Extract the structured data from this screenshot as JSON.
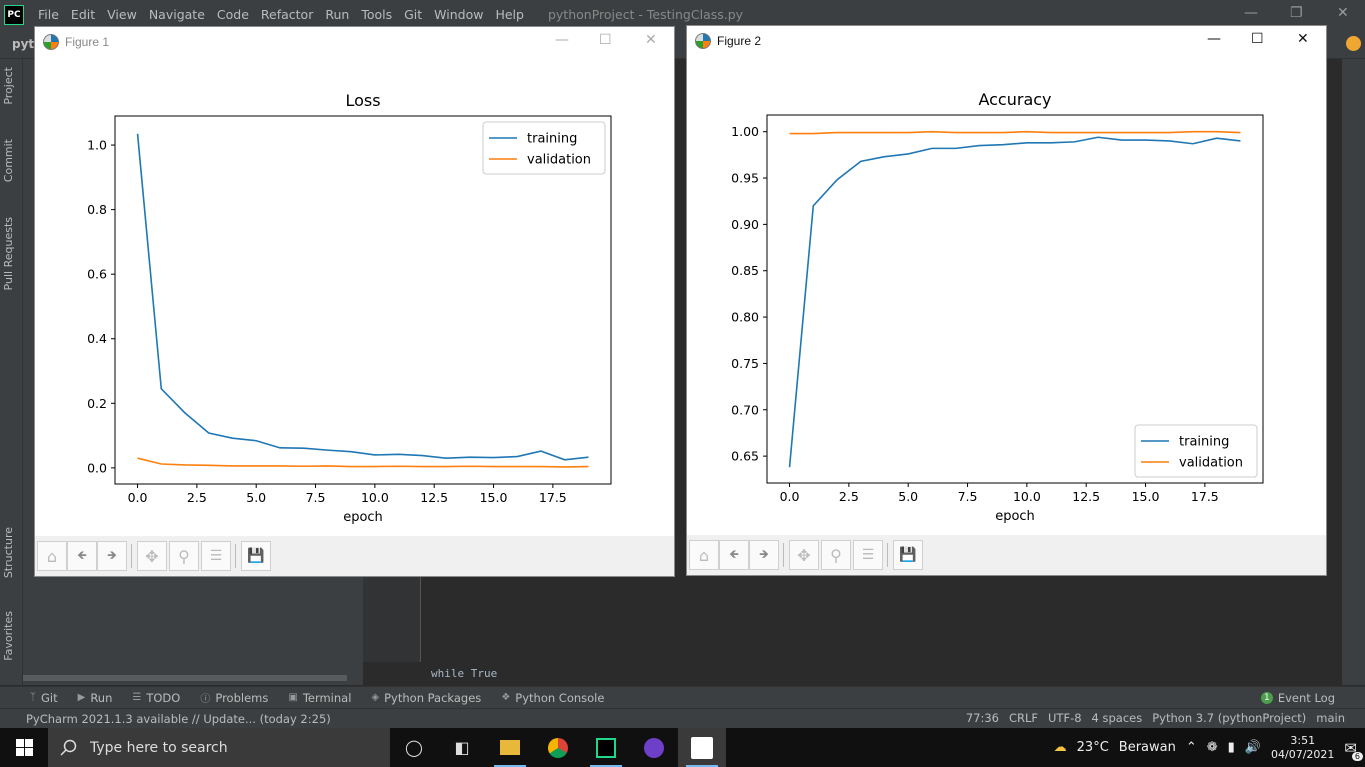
{
  "ide": {
    "logo": "PC",
    "menu": [
      "File",
      "Edit",
      "View",
      "Navigate",
      "Code",
      "Refactor",
      "Run",
      "Tools",
      "Git",
      "Window",
      "Help"
    ],
    "window_title": "pythonProject - TestingClass.py",
    "project_crumb": "pyth",
    "left_tabs": [
      "Project",
      "Commit",
      "Pull Requests",
      "Structure",
      "Favorites"
    ],
    "editor_snippet": "while True",
    "tool_tabs": [
      {
        "icon": "git-icon",
        "label": "Git"
      },
      {
        "icon": "run-icon",
        "label": "Run"
      },
      {
        "icon": "todo-icon",
        "label": "TODO"
      },
      {
        "icon": "problems-icon",
        "label": "Problems"
      },
      {
        "icon": "terminal-icon",
        "label": "Terminal"
      },
      {
        "icon": "python-packages-icon",
        "label": "Python Packages"
      },
      {
        "icon": "python-console-icon",
        "label": "Python Console"
      }
    ],
    "event_log": {
      "count": "1",
      "label": "Event Log"
    },
    "status": {
      "message": "PyCharm 2021.1.3 available // Update... (today 2:25)",
      "position": "77:36",
      "line_sep": "CRLF",
      "encoding": "UTF-8",
      "indent": "4 spaces",
      "interpreter": "Python 3.7 (pythonProject)",
      "branch": "main"
    }
  },
  "taskbar": {
    "search_placeholder": "Type here to search",
    "weather_temp": "23°C",
    "weather_text": "Berawan",
    "time": "3:51",
    "date": "04/07/2021",
    "notifications": "6"
  },
  "figure1": {
    "title": "Figure 1"
  },
  "figure2": {
    "title": "Figure 2"
  },
  "colors": {
    "training": "#1f77b4",
    "validation": "#ff7f0e"
  },
  "chart_data": [
    {
      "type": "line",
      "title": "Loss",
      "xlabel": "epoch",
      "ylabel": "",
      "x": [
        0,
        1,
        2,
        3,
        4,
        5,
        6,
        7,
        8,
        9,
        10,
        11,
        12,
        13,
        14,
        15,
        16,
        17,
        18,
        19
      ],
      "xlim": [
        -0.95,
        19.95
      ],
      "ylim": [
        -0.05,
        1.09
      ],
      "xticks": [
        0.0,
        2.5,
        5.0,
        7.5,
        10.0,
        12.5,
        15.0,
        17.5
      ],
      "xtick_labels": [
        "0.0",
        "2.5",
        "5.0",
        "7.5",
        "10.0",
        "12.5",
        "15.0",
        "17.5"
      ],
      "yticks": [
        0.0,
        0.2,
        0.4,
        0.6,
        0.8,
        1.0
      ],
      "ytick_labels": [
        "0.0",
        "0.2",
        "0.4",
        "0.6",
        "0.8",
        "1.0"
      ],
      "legend_position": "upper right",
      "series": [
        {
          "name": "training",
          "values": [
            1.035,
            0.245,
            0.17,
            0.108,
            0.092,
            0.084,
            0.062,
            0.061,
            0.055,
            0.05,
            0.04,
            0.042,
            0.038,
            0.03,
            0.033,
            0.032,
            0.035,
            0.052,
            0.025,
            0.033
          ]
        },
        {
          "name": "validation",
          "values": [
            0.03,
            0.012,
            0.009,
            0.008,
            0.006,
            0.006,
            0.006,
            0.005,
            0.006,
            0.004,
            0.004,
            0.005,
            0.004,
            0.004,
            0.005,
            0.004,
            0.004,
            0.004,
            0.003,
            0.004
          ]
        }
      ]
    },
    {
      "type": "line",
      "title": "Accuracy",
      "xlabel": "epoch",
      "ylabel": "",
      "x": [
        0,
        1,
        2,
        3,
        4,
        5,
        6,
        7,
        8,
        9,
        10,
        11,
        12,
        13,
        14,
        15,
        16,
        17,
        18,
        19
      ],
      "xlim": [
        -0.95,
        19.95
      ],
      "ylim": [
        0.621,
        1.018
      ],
      "xticks": [
        0.0,
        2.5,
        5.0,
        7.5,
        10.0,
        12.5,
        15.0,
        17.5
      ],
      "xtick_labels": [
        "0.0",
        "2.5",
        "5.0",
        "7.5",
        "10.0",
        "12.5",
        "15.0",
        "17.5"
      ],
      "yticks": [
        0.65,
        0.7,
        0.75,
        0.8,
        0.85,
        0.9,
        0.95,
        1.0
      ],
      "ytick_labels": [
        "0.65",
        "0.70",
        "0.75",
        "0.80",
        "0.85",
        "0.90",
        "0.95",
        "1.00"
      ],
      "legend_position": "lower right",
      "series": [
        {
          "name": "training",
          "values": [
            0.638,
            0.92,
            0.948,
            0.968,
            0.973,
            0.976,
            0.982,
            0.982,
            0.985,
            0.986,
            0.988,
            0.988,
            0.989,
            0.994,
            0.991,
            0.991,
            0.99,
            0.987,
            0.993,
            0.99
          ]
        },
        {
          "name": "validation",
          "values": [
            0.998,
            0.998,
            0.999,
            0.999,
            0.999,
            0.999,
            1.0,
            0.999,
            0.999,
            0.999,
            1.0,
            0.999,
            0.999,
            0.999,
            0.999,
            0.999,
            0.999,
            1.0,
            1.0,
            0.999
          ]
        }
      ]
    }
  ]
}
